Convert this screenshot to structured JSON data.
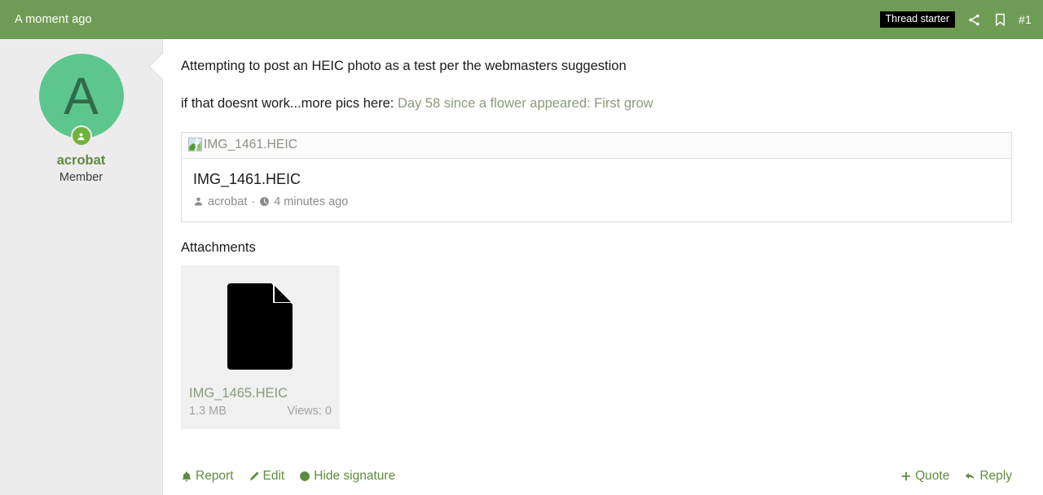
{
  "header": {
    "date": "A moment ago",
    "thread_starter_badge": "Thread starter",
    "share_icon": "share-icon",
    "bookmark_icon": "bookmark-icon",
    "post_number": "#1"
  },
  "user": {
    "avatar_initial": "A",
    "avatar_bg": "#5cc68e",
    "avatar_fg": "#2f6b4b",
    "status_icon": "user-status-icon",
    "username": "acrobat",
    "user_title": "Member"
  },
  "message": {
    "paragraph1": "Attempting to post an HEIC photo as a test per the webmasters suggestion",
    "paragraph2_prefix": "if that doesnt work...more pics here: ",
    "link_text": "Day 58 since a flower appeared: First grow",
    "link_color": "#8a9a7b"
  },
  "embed": {
    "broken_image_icon": "broken-image-icon",
    "broken_image_alt": "IMG_1461.HEIC",
    "title": "IMG_1461.HEIC",
    "author_icon": "user-icon",
    "author": "acrobat",
    "separator": "·",
    "time_icon": "clock-icon",
    "time": "4 minutes ago"
  },
  "attachments": {
    "heading": "Attachments",
    "items": [
      {
        "file_icon": "file-document-icon",
        "name": "IMG_1465.HEIC",
        "size": "1.3 MB",
        "views": "Views: 0"
      }
    ]
  },
  "footer": {
    "left_actions": [
      {
        "icon": "bell-icon",
        "label": "Report"
      },
      {
        "icon": "pencil-icon",
        "label": "Edit"
      },
      {
        "icon": "globe-icon",
        "label": "Hide signature"
      }
    ],
    "right_actions": [
      {
        "icon": "plus-icon",
        "label": "Quote"
      },
      {
        "icon": "reply-arrow-icon",
        "label": "Reply"
      }
    ]
  },
  "colors": {
    "header_green": "#6f9c54",
    "link_green": "#5f8b3f",
    "sidebar_bg": "#ececec"
  }
}
